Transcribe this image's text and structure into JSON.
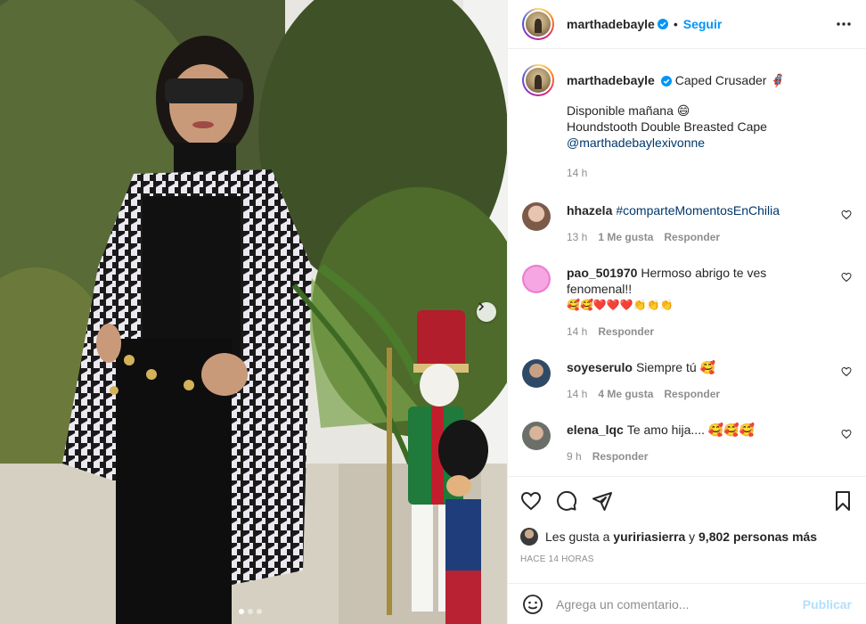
{
  "post": {
    "username": "marthadebayle",
    "follow_label": "Seguir",
    "more_icon": "more-horizontal-icon",
    "verified_color": "#0095f6"
  },
  "caption": {
    "username": "marthadebayle",
    "title": "Caped Crusader ",
    "title_emoji": "🦸🏻‍♀️",
    "lines": [
      "Disponible mañana 😄",
      "Houndstooth Double Breasted Cape"
    ],
    "mention": "@marthadebaylexivonne",
    "time": "14 h"
  },
  "comments": [
    {
      "username": "hhazela",
      "text": "#comparteMomentosEnChilia",
      "time": "13 h",
      "likes": "1 Me gusta",
      "reply": "Responder"
    },
    {
      "username": "pao_501970",
      "text": "Hermoso abrigo te ves fenomenal!! ",
      "emoji": "🥰🥰❤️❤️❤️👏👏👏",
      "time": "14 h",
      "likes": "",
      "reply": "Responder"
    },
    {
      "username": "soyeserulo",
      "text": "Siempre tú 🥰",
      "time": "14 h",
      "likes": "4 Me gusta",
      "reply": "Responder"
    },
    {
      "username": "elena_lqc",
      "text": "Te amo hija.... 🥰🥰🥰",
      "time": "9 h",
      "likes": "",
      "reply": "Responder"
    }
  ],
  "likes": {
    "prefix": "Les gusta a ",
    "user": "yuririasierra",
    "middle": " y ",
    "count": "9,802 personas más"
  },
  "posted_ago": "HACE 14 HORAS",
  "add_comment": {
    "placeholder": "Agrega un comentario...",
    "publish_label": "Publicar"
  },
  "carousel": {
    "count": 3,
    "active": 0
  },
  "colors": {
    "accent": "#0095f6",
    "muted": "#8e8e8e",
    "publish_disabled": "#b2dffc"
  }
}
